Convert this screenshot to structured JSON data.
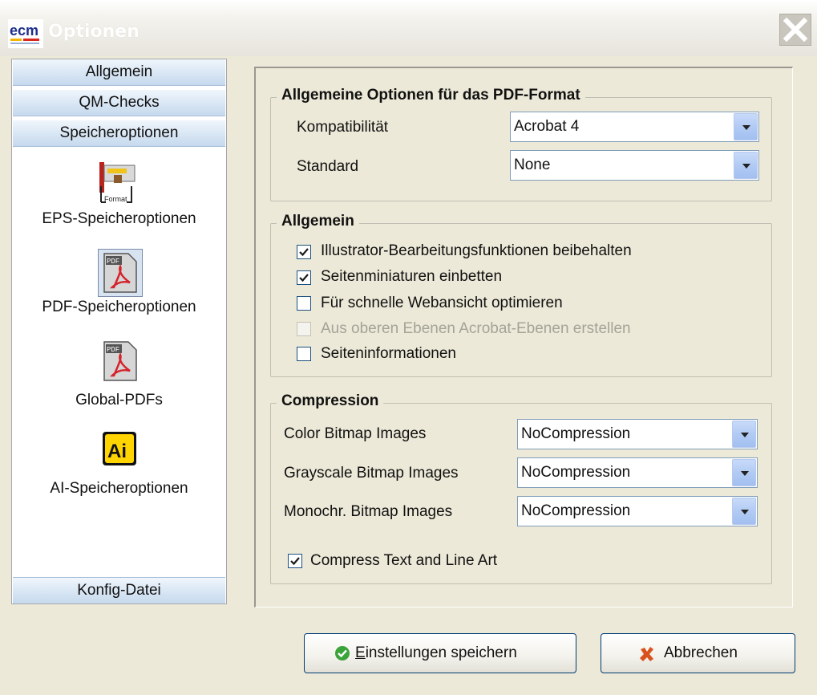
{
  "window": {
    "title": "Optionen",
    "logo_text": "ecm"
  },
  "nav": {
    "tabs_top": [
      {
        "label": "Allgemein"
      },
      {
        "label": "QM-Checks"
      },
      {
        "label": "Speicheroptionen"
      }
    ],
    "items": [
      {
        "label": "EPS-Speicheroptionen",
        "icon": "eps-format-icon",
        "icon_text": "Format"
      },
      {
        "label": "PDF-Speicheroptionen",
        "icon": "pdf-document-icon",
        "icon_text": "PDF",
        "selected": true
      },
      {
        "label": "Global-PDFs",
        "icon": "pdf-document-icon",
        "icon_text": "PDF"
      },
      {
        "label": "AI-Speicheroptionen",
        "icon": "adobe-illustrator-icon",
        "icon_text": "Ai"
      }
    ],
    "tab_bottom": {
      "label": "Konfig-Datei"
    }
  },
  "pdf_format": {
    "legend": "Allgemeine Optionen für das PDF-Format",
    "compat_label": "Kompatibilität",
    "compat_value": "Acrobat 4",
    "standard_label": "Standard",
    "standard_value": "None"
  },
  "allgemein": {
    "legend": "Allgemein",
    "options": [
      {
        "label": "Illustrator-Bearbeitungsfunktionen beibehalten",
        "checked": true,
        "enabled": true
      },
      {
        "label": "Seitenminiaturen einbetten",
        "checked": true,
        "enabled": true
      },
      {
        "label": "Für schnelle Webansicht optimieren",
        "checked": false,
        "enabled": true
      },
      {
        "label": "Aus oberen Ebenen Acrobat-Ebenen erstellen",
        "checked": false,
        "enabled": false
      },
      {
        "label": "Seiteninformationen",
        "checked": false,
        "enabled": true
      }
    ]
  },
  "compression": {
    "legend": "Compression",
    "rows": [
      {
        "label": "Color Bitmap Images",
        "value": "NoCompression"
      },
      {
        "label": "Grayscale Bitmap Images",
        "value": "NoCompression"
      },
      {
        "label": "Monochr. Bitmap Images",
        "value": "NoCompression"
      }
    ],
    "compress_text": {
      "label": "Compress Text and Line Art",
      "checked": true
    }
  },
  "buttons": {
    "save_first": "E",
    "save_rest": "instellungen speichern",
    "cancel": "Abbrechen"
  },
  "colors": {
    "window_bg": "#ece9d8",
    "nav_tab": "#d8e6f4",
    "combo_border": "#7f9db9",
    "check_border": "#1c5180",
    "save_icon": "#3aa33a",
    "cancel_icon": "#d9531e"
  }
}
